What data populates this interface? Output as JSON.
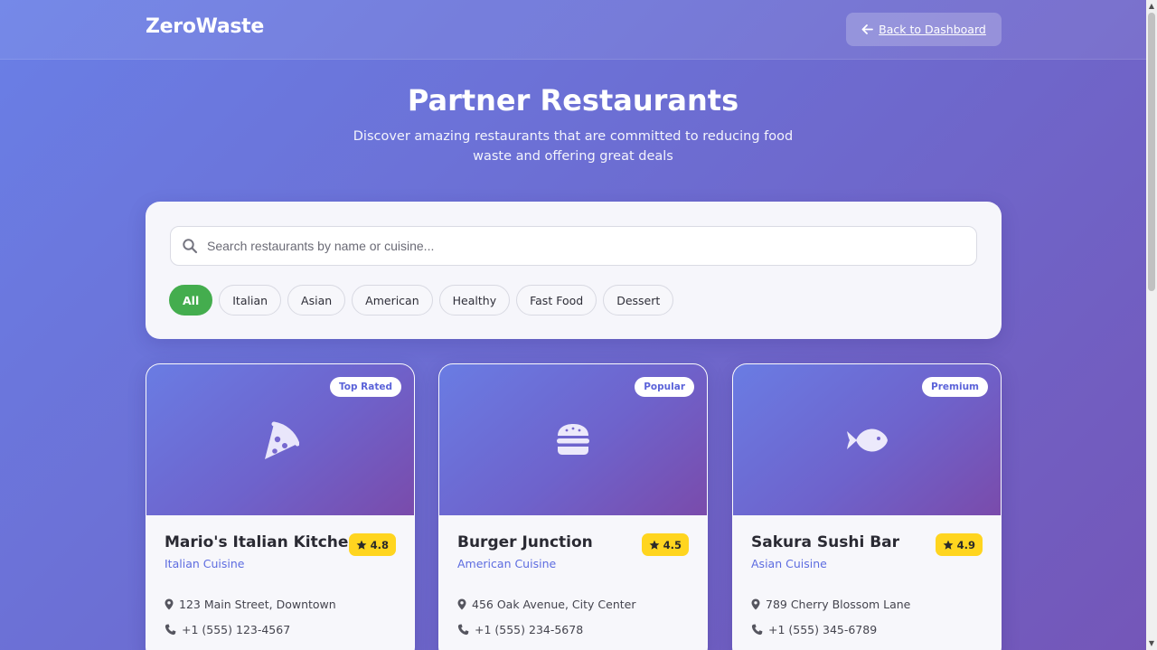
{
  "header": {
    "logo": "ZeroWaste",
    "back_label": "Back to Dashboard"
  },
  "hero": {
    "title": "Partner Restaurants",
    "subtitle": "Discover amazing restaurants that are committed to reducing food waste and offering great deals"
  },
  "search": {
    "placeholder": "Search restaurants by name or cuisine...",
    "value": ""
  },
  "filters": {
    "active": "All",
    "items": [
      "All",
      "Italian",
      "Asian",
      "American",
      "Healthy",
      "Fast Food",
      "Dessert"
    ]
  },
  "restaurants": [
    {
      "badge": "Top Rated",
      "icon": "pizza-icon",
      "name": "Mario's Italian Kitchen",
      "rating": "4.8",
      "cuisine": "Italian Cuisine",
      "address": "123 Main Street, Downtown",
      "phone": "+1 (555) 123-4567"
    },
    {
      "badge": "Popular",
      "icon": "burger-icon",
      "name": "Burger Junction",
      "rating": "4.5",
      "cuisine": "American Cuisine",
      "address": "456 Oak Avenue, City Center",
      "phone": "+1 (555) 234-5678"
    },
    {
      "badge": "Premium",
      "icon": "fish-icon",
      "name": "Sakura Sushi Bar",
      "rating": "4.9",
      "cuisine": "Asian Cuisine",
      "address": "789 Cherry Blossom Lane",
      "phone": "+1 (555) 345-6789"
    }
  ],
  "colors": {
    "accent": "#5d6ce0",
    "active_chip": "#44ad4e",
    "rating_badge": "#ffd51f"
  }
}
